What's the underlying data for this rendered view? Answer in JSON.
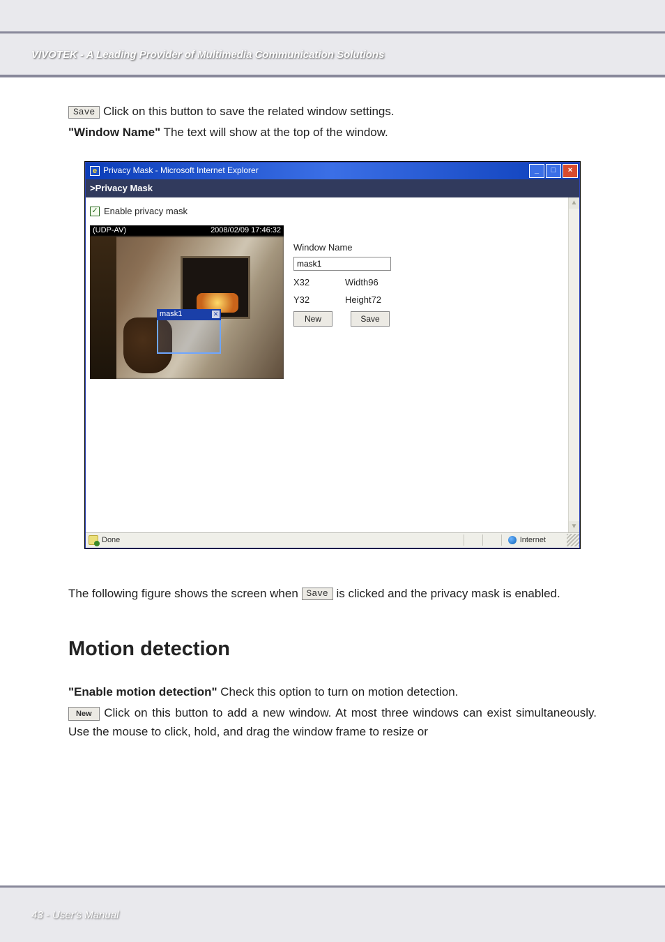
{
  "header": {
    "title": "VIVOTEK - A Leading Provider of Multimedia Communication Solutions"
  },
  "buttons": {
    "save": "Save",
    "new": "New"
  },
  "intro": {
    "save_text": " Click on this button to save the related window settings.",
    "window_name_label": "\"Window Name\"",
    "window_name_text": " The text will show at the top of the window."
  },
  "ie": {
    "title": "Privacy Mask - Microsoft Internet Explorer",
    "subheader": ">Privacy Mask",
    "checkbox_label": "Enable privacy mask",
    "video": {
      "src_label": "(UDP-AV)",
      "timestamp": "2008/02/09 17:46:32",
      "mask_label": "mask1"
    },
    "panel": {
      "window_name_label": "Window Name",
      "window_name_value": "mask1",
      "x_label": "X32",
      "width_label": "Width96",
      "y_label": "Y32",
      "height_label": "Height72",
      "new_btn": "New",
      "save_btn": "Save"
    },
    "status": {
      "done": "Done",
      "zone": "Internet"
    },
    "win_btns": {
      "min": "_",
      "max": "□",
      "close": "×"
    }
  },
  "after": {
    "pre": "The following figure shows the screen when ",
    "post": " is clicked and the privacy mask is enabled."
  },
  "motion": {
    "heading": "Motion detection",
    "enable_label": "\"Enable motion detection\"",
    "enable_text": " Check this option to turn on motion detection.",
    "new_text": " Click on this button to add a new window. At most three windows can exist simultaneously. Use the mouse to click, hold, and drag the window frame to resize or"
  },
  "footer": {
    "text": "43 - User's Manual"
  }
}
